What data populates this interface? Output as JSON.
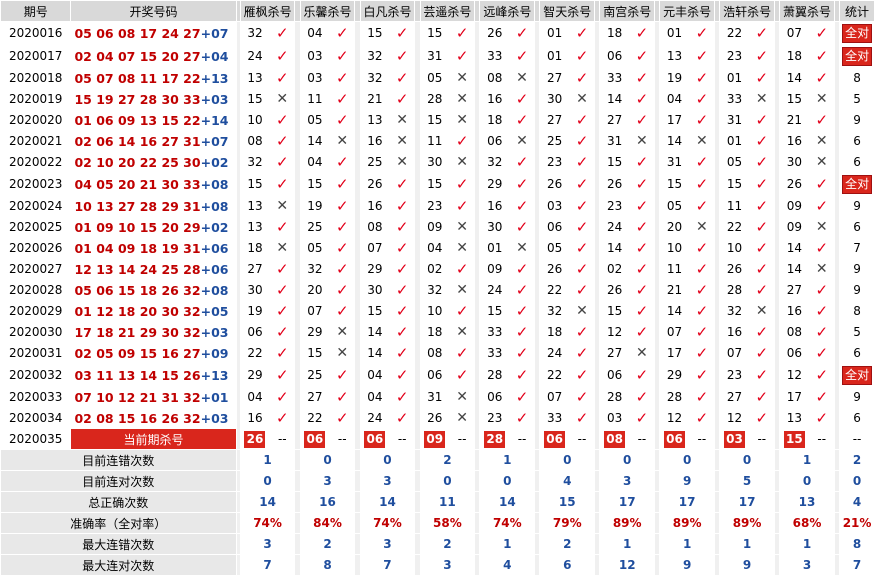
{
  "headers": {
    "issue": "期号",
    "numbers": "开奖号码",
    "experts": [
      "雁枫杀号",
      "乐馨杀号",
      "白凡杀号",
      "芸遥杀号",
      "远峰杀号",
      "智天杀号",
      "南宫杀号",
      "元丰杀号",
      "浩轩杀号",
      "萧翼杀号"
    ],
    "stat": "统计"
  },
  "marks": {
    "ok": "✓",
    "no": "✕"
  },
  "rows": [
    {
      "issue": "2020016",
      "red": "05 06 08 17 24 27",
      "blue": "+07",
      "picks": [
        [
          "32",
          1
        ],
        [
          "04",
          1
        ],
        [
          "15",
          1
        ],
        [
          "15",
          1
        ],
        [
          "26",
          1
        ],
        [
          "01",
          1
        ],
        [
          "18",
          1
        ],
        [
          "01",
          1
        ],
        [
          "22",
          1
        ],
        [
          "07",
          1
        ]
      ],
      "stat": "全对",
      "all": true
    },
    {
      "issue": "2020017",
      "red": "02 04 07 15 20 27",
      "blue": "+04",
      "picks": [
        [
          "24",
          1
        ],
        [
          "03",
          1
        ],
        [
          "32",
          1
        ],
        [
          "31",
          1
        ],
        [
          "33",
          1
        ],
        [
          "01",
          1
        ],
        [
          "06",
          1
        ],
        [
          "13",
          1
        ],
        [
          "23",
          1
        ],
        [
          "18",
          1
        ]
      ],
      "stat": "全对",
      "all": true
    },
    {
      "issue": "2020018",
      "red": "05 07 08 11 17 22",
      "blue": "+13",
      "picks": [
        [
          "13",
          1
        ],
        [
          "03",
          1
        ],
        [
          "32",
          1
        ],
        [
          "05",
          0
        ],
        [
          "08",
          0
        ],
        [
          "27",
          1
        ],
        [
          "33",
          1
        ],
        [
          "19",
          1
        ],
        [
          "01",
          1
        ],
        [
          "14",
          1
        ]
      ],
      "stat": "8",
      "all": false
    },
    {
      "issue": "2020019",
      "red": "15 19 27 28 30 33",
      "blue": "+03",
      "picks": [
        [
          "15",
          0
        ],
        [
          "11",
          1
        ],
        [
          "21",
          1
        ],
        [
          "28",
          0
        ],
        [
          "16",
          1
        ],
        [
          "30",
          0
        ],
        [
          "14",
          1
        ],
        [
          "04",
          1
        ],
        [
          "33",
          0
        ],
        [
          "15",
          0
        ]
      ],
      "stat": "5",
      "all": false
    },
    {
      "issue": "2020020",
      "red": "01 06 09 13 15 22",
      "blue": "+14",
      "picks": [
        [
          "10",
          1
        ],
        [
          "05",
          1
        ],
        [
          "13",
          0
        ],
        [
          "15",
          0
        ],
        [
          "18",
          1
        ],
        [
          "27",
          1
        ],
        [
          "27",
          1
        ],
        [
          "17",
          1
        ],
        [
          "31",
          1
        ],
        [
          "21",
          1
        ]
      ],
      "stat": "9",
      "all": false
    },
    {
      "issue": "2020021",
      "red": "02 06 14 16 27 31",
      "blue": "+07",
      "picks": [
        [
          "08",
          1
        ],
        [
          "14",
          0
        ],
        [
          "16",
          0
        ],
        [
          "11",
          1
        ],
        [
          "06",
          0
        ],
        [
          "25",
          1
        ],
        [
          "31",
          0
        ],
        [
          "14",
          0
        ],
        [
          "01",
          1
        ],
        [
          "16",
          0
        ]
      ],
      "stat": "6",
      "all": false
    },
    {
      "issue": "2020022",
      "red": "02 10 20 22 25 30",
      "blue": "+02",
      "picks": [
        [
          "32",
          1
        ],
        [
          "04",
          1
        ],
        [
          "25",
          0
        ],
        [
          "30",
          0
        ],
        [
          "32",
          1
        ],
        [
          "23",
          1
        ],
        [
          "15",
          1
        ],
        [
          "31",
          1
        ],
        [
          "05",
          1
        ],
        [
          "30",
          0
        ]
      ],
      "stat": "6",
      "all": false
    },
    {
      "issue": "2020023",
      "red": "04 05 20 21 30 33",
      "blue": "+08",
      "picks": [
        [
          "15",
          1
        ],
        [
          "15",
          1
        ],
        [
          "26",
          1
        ],
        [
          "15",
          1
        ],
        [
          "29",
          1
        ],
        [
          "26",
          1
        ],
        [
          "26",
          1
        ],
        [
          "15",
          1
        ],
        [
          "15",
          1
        ],
        [
          "26",
          1
        ]
      ],
      "stat": "全对",
      "all": true
    },
    {
      "issue": "2020024",
      "red": "10 13 27 28 29 31",
      "blue": "+08",
      "picks": [
        [
          "13",
          0
        ],
        [
          "19",
          1
        ],
        [
          "16",
          1
        ],
        [
          "23",
          1
        ],
        [
          "16",
          1
        ],
        [
          "03",
          1
        ],
        [
          "23",
          1
        ],
        [
          "05",
          1
        ],
        [
          "11",
          1
        ],
        [
          "09",
          1
        ]
      ],
      "stat": "9",
      "all": false
    },
    {
      "issue": "2020025",
      "red": "01 09 10 15 20 29",
      "blue": "+02",
      "picks": [
        [
          "13",
          1
        ],
        [
          "25",
          1
        ],
        [
          "08",
          1
        ],
        [
          "09",
          0
        ],
        [
          "30",
          1
        ],
        [
          "06",
          1
        ],
        [
          "24",
          1
        ],
        [
          "20",
          0
        ],
        [
          "22",
          1
        ],
        [
          "09",
          0
        ]
      ],
      "stat": "6",
      "all": false
    },
    {
      "issue": "2020026",
      "red": "01 04 09 18 19 31",
      "blue": "+06",
      "picks": [
        [
          "18",
          0
        ],
        [
          "05",
          1
        ],
        [
          "07",
          1
        ],
        [
          "04",
          0
        ],
        [
          "01",
          0
        ],
        [
          "05",
          1
        ],
        [
          "14",
          1
        ],
        [
          "10",
          1
        ],
        [
          "10",
          1
        ],
        [
          "14",
          1
        ]
      ],
      "stat": "7",
      "all": false
    },
    {
      "issue": "2020027",
      "red": "12 13 14 24 25 28",
      "blue": "+06",
      "picks": [
        [
          "27",
          1
        ],
        [
          "32",
          1
        ],
        [
          "29",
          1
        ],
        [
          "02",
          1
        ],
        [
          "09",
          1
        ],
        [
          "26",
          1
        ],
        [
          "02",
          1
        ],
        [
          "11",
          1
        ],
        [
          "26",
          1
        ],
        [
          "14",
          0
        ]
      ],
      "stat": "9",
      "all": false
    },
    {
      "issue": "2020028",
      "red": "05 06 15 18 26 32",
      "blue": "+08",
      "picks": [
        [
          "30",
          1
        ],
        [
          "20",
          1
        ],
        [
          "30",
          1
        ],
        [
          "32",
          0
        ],
        [
          "24",
          1
        ],
        [
          "22",
          1
        ],
        [
          "26",
          1
        ],
        [
          "21",
          1
        ],
        [
          "28",
          1
        ],
        [
          "27",
          1
        ]
      ],
      "stat": "9",
      "all": false
    },
    {
      "issue": "2020029",
      "red": "01 12 18 20 30 32",
      "blue": "+05",
      "picks": [
        [
          "19",
          1
        ],
        [
          "07",
          1
        ],
        [
          "15",
          1
        ],
        [
          "10",
          1
        ],
        [
          "15",
          1
        ],
        [
          "32",
          0
        ],
        [
          "15",
          1
        ],
        [
          "14",
          1
        ],
        [
          "32",
          0
        ],
        [
          "16",
          1
        ]
      ],
      "stat": "8",
      "all": false
    },
    {
      "issue": "2020030",
      "red": "17 18 21 29 30 32",
      "blue": "+03",
      "picks": [
        [
          "06",
          1
        ],
        [
          "29",
          0
        ],
        [
          "14",
          1
        ],
        [
          "18",
          0
        ],
        [
          "33",
          1
        ],
        [
          "18",
          1
        ],
        [
          "12",
          1
        ],
        [
          "07",
          1
        ],
        [
          "16",
          1
        ],
        [
          "08",
          1
        ]
      ],
      "stat": "5",
      "all": false
    },
    {
      "issue": "2020031",
      "red": "02 05 09 15 16 27",
      "blue": "+09",
      "picks": [
        [
          "22",
          1
        ],
        [
          "15",
          0
        ],
        [
          "14",
          1
        ],
        [
          "08",
          1
        ],
        [
          "33",
          1
        ],
        [
          "24",
          1
        ],
        [
          "27",
          0
        ],
        [
          "17",
          1
        ],
        [
          "07",
          1
        ],
        [
          "06",
          1
        ]
      ],
      "stat": "6",
      "all": false
    },
    {
      "issue": "2020032",
      "red": "03 11 13 14 15 26",
      "blue": "+13",
      "picks": [
        [
          "29",
          1
        ],
        [
          "25",
          1
        ],
        [
          "04",
          1
        ],
        [
          "06",
          1
        ],
        [
          "28",
          1
        ],
        [
          "22",
          1
        ],
        [
          "06",
          1
        ],
        [
          "29",
          1
        ],
        [
          "23",
          1
        ],
        [
          "12",
          1
        ]
      ],
      "stat": "全对",
      "all": true
    },
    {
      "issue": "2020033",
      "red": "07 10 12 21 31 32",
      "blue": "+01",
      "picks": [
        [
          "04",
          1
        ],
        [
          "27",
          1
        ],
        [
          "04",
          1
        ],
        [
          "31",
          0
        ],
        [
          "06",
          1
        ],
        [
          "07",
          1
        ],
        [
          "28",
          1
        ],
        [
          "28",
          1
        ],
        [
          "27",
          1
        ],
        [
          "17",
          1
        ]
      ],
      "stat": "9",
      "all": false
    },
    {
      "issue": "2020034",
      "red": "02 08 15 16 26 32",
      "blue": "+03",
      "picks": [
        [
          "16",
          1
        ],
        [
          "22",
          1
        ],
        [
          "24",
          1
        ],
        [
          "26",
          0
        ],
        [
          "23",
          1
        ],
        [
          "33",
          1
        ],
        [
          "03",
          1
        ],
        [
          "12",
          1
        ],
        [
          "12",
          1
        ],
        [
          "13",
          1
        ]
      ],
      "stat": "6",
      "all": false
    }
  ],
  "current": {
    "issue": "2020035",
    "label": "当前期杀号",
    "kills": [
      "26",
      "06",
      "06",
      "09",
      "28",
      "06",
      "08",
      "06",
      "03",
      "15"
    ],
    "dash": "--"
  },
  "stats": [
    {
      "label": "目前连错次数",
      "values": [
        "1",
        "0",
        "0",
        "2",
        "1",
        "0",
        "0",
        "0",
        "0",
        "1"
      ],
      "total": "2",
      "pct": false
    },
    {
      "label": "目前连对次数",
      "values": [
        "0",
        "3",
        "3",
        "0",
        "0",
        "4",
        "3",
        "9",
        "5",
        "0"
      ],
      "total": "0",
      "pct": false
    },
    {
      "label": "总正确次数",
      "values": [
        "14",
        "16",
        "14",
        "11",
        "14",
        "15",
        "17",
        "17",
        "17",
        "13"
      ],
      "total": "4",
      "pct": false
    },
    {
      "label": "准确率（全对率）",
      "values": [
        "74%",
        "84%",
        "74%",
        "58%",
        "74%",
        "79%",
        "89%",
        "89%",
        "89%",
        "68%"
      ],
      "total": "21%",
      "pct": true
    },
    {
      "label": "最大连错次数",
      "values": [
        "3",
        "2",
        "3",
        "2",
        "1",
        "2",
        "1",
        "1",
        "1",
        "1"
      ],
      "total": "8",
      "pct": false
    },
    {
      "label": "最大连对次数",
      "values": [
        "7",
        "8",
        "7",
        "3",
        "4",
        "6",
        "12",
        "9",
        "9",
        "3"
      ],
      "total": "7",
      "pct": false
    }
  ]
}
